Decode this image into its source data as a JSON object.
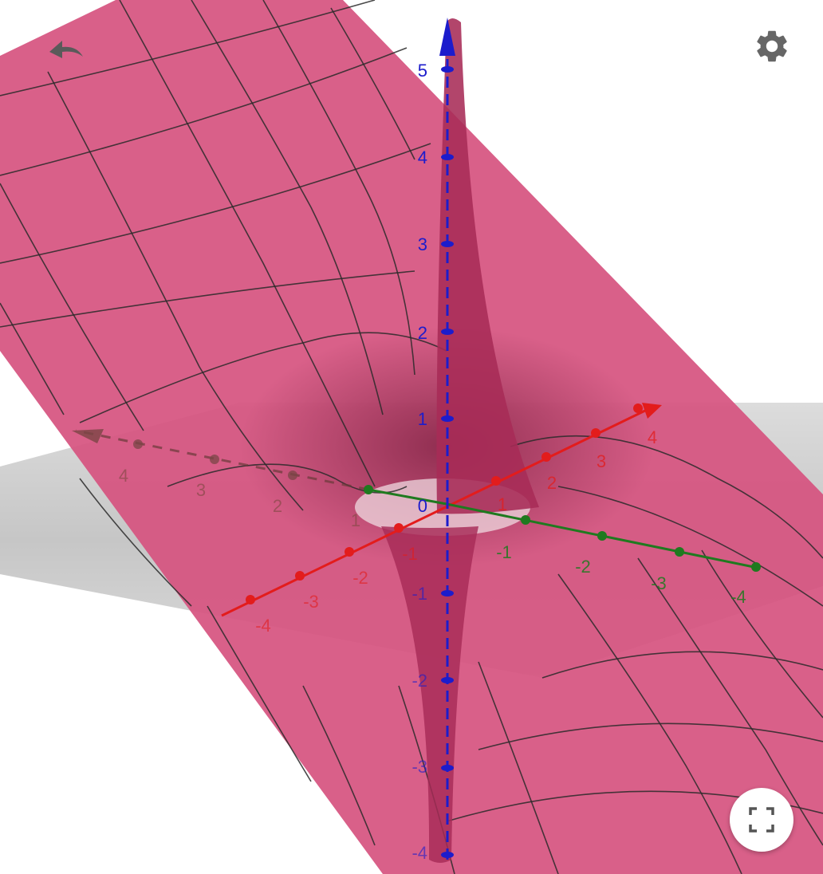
{
  "app": {
    "controls": {
      "undo_icon": "undo-arrow",
      "settings_icon": "gear",
      "fullscreen_icon": "fullscreen-corners"
    }
  },
  "scene": {
    "colors": {
      "surface": "#d6527f",
      "surface_dark": "#b3325f",
      "funnel": "#a72b57",
      "xy_plane": "#9a9a9a",
      "x_axis": "#e31c1c",
      "y_axis": "#1f7a1f",
      "z_axis": "#1c1ccc",
      "grid_line": "#2a2a2a"
    },
    "axes": {
      "x": {
        "color": "#e31c1c",
        "ticks": [
          {
            "label": "4"
          },
          {
            "label": "3"
          },
          {
            "label": "2"
          },
          {
            "label": "1"
          },
          {
            "label": "-1"
          },
          {
            "label": "-2"
          },
          {
            "label": "-3"
          },
          {
            "label": "-4"
          }
        ]
      },
      "y": {
        "color": "#1f7a1f",
        "ticks": [
          {
            "label": "4"
          },
          {
            "label": "3"
          },
          {
            "label": "2"
          },
          {
            "label": "1"
          },
          {
            "label": "-1"
          },
          {
            "label": "-2"
          },
          {
            "label": "-3"
          },
          {
            "label": "-4"
          }
        ]
      },
      "z": {
        "color": "#1c1ccc",
        "ticks": [
          {
            "label": "5"
          },
          {
            "label": "4"
          },
          {
            "label": "3"
          },
          {
            "label": "2"
          },
          {
            "label": "1"
          },
          {
            "label": "0"
          },
          {
            "label": "-1"
          },
          {
            "label": "-2"
          },
          {
            "label": "-3"
          },
          {
            "label": "-4"
          }
        ]
      }
    }
  }
}
